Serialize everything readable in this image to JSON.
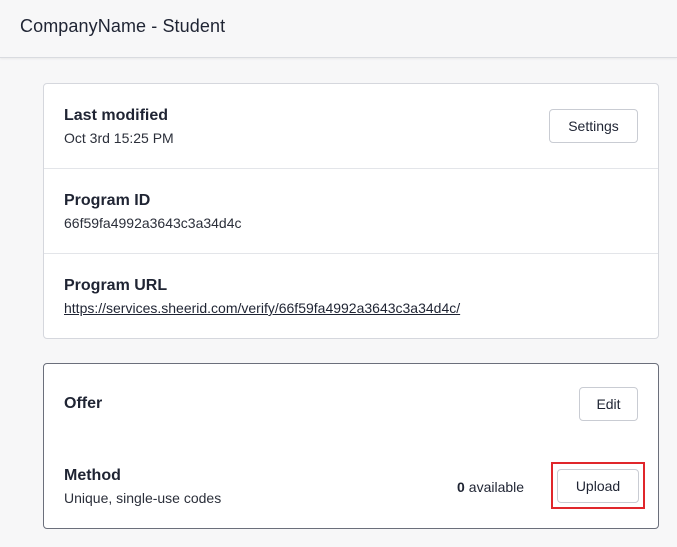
{
  "header": {
    "title": "CompanyName - Student"
  },
  "info_card": {
    "last_modified": {
      "label": "Last modified",
      "value": "Oct 3rd 15:25 PM",
      "settings_button": "Settings"
    },
    "program_id": {
      "label": "Program ID",
      "value": "66f59fa4992a3643c3a34d4c"
    },
    "program_url": {
      "label": "Program URL",
      "value": "https://services.sheerid.com/verify/66f59fa4992a3643c3a34d4c/"
    }
  },
  "offer_card": {
    "title": "Offer",
    "edit_button": "Edit",
    "method": {
      "label": "Method",
      "value": "Unique, single-use codes",
      "available_count": "0",
      "available_label": "available",
      "upload_button": "Upload"
    }
  },
  "colors": {
    "highlight": "#e0262b",
    "background": "#f7f7f8",
    "card": "#ffffff"
  }
}
